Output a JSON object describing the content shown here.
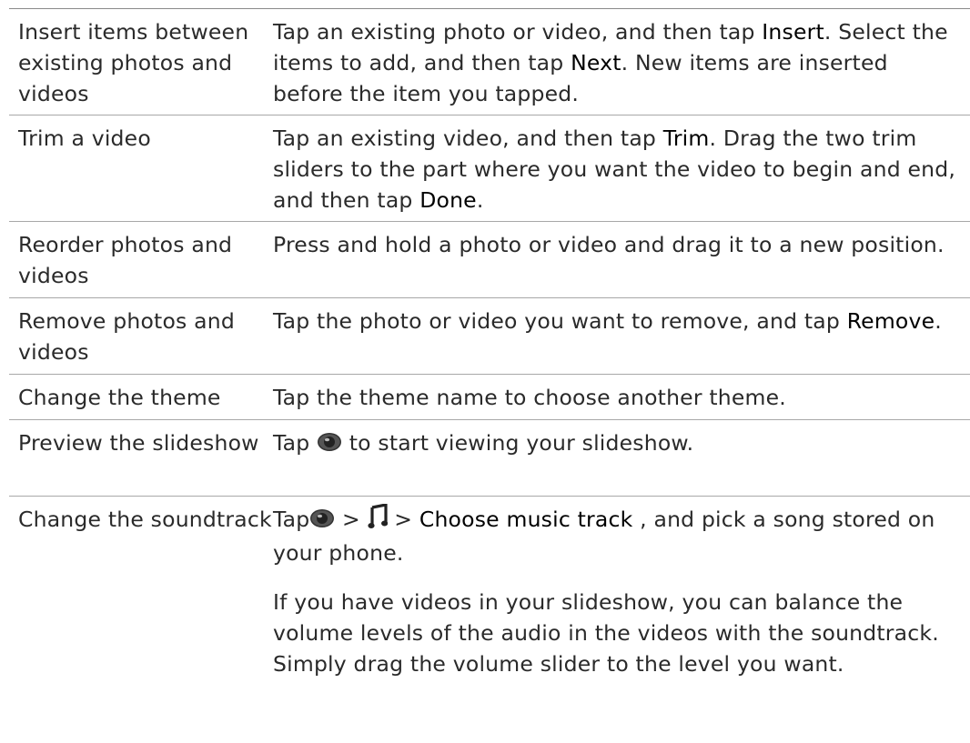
{
  "rows": [
    {
      "action": "Insert items between existing photos and videos",
      "desc": {
        "t1": "Tap an existing photo or video, and then tap ",
        "k1": "Insert",
        "t2": ". Select the items to add, and then tap ",
        "k2": "Next",
        "t3": ". New items are inserted before the item you tapped."
      }
    },
    {
      "action": "Trim a video",
      "desc": {
        "t1": "Tap an existing video, and then tap ",
        "k1": "Trim",
        "t2": ". Drag the two trim sliders to the part where you want the video to begin and end, and then tap ",
        "k2": "Done",
        "t3": "."
      }
    },
    {
      "action": "Reorder photos and videos",
      "desc": {
        "t1": "Press and hold a photo or video and drag it to a new position."
      }
    },
    {
      "action": "Remove photos and videos",
      "desc": {
        "t1": "Tap the photo or video you want to remove, and tap ",
        "k1": "Remove",
        "t2": "."
      }
    },
    {
      "action": "Change the theme",
      "desc": {
        "t1": "Tap the theme name to choose another theme."
      }
    },
    {
      "action": "Preview the slideshow",
      "desc": {
        "t1": "Tap ",
        "icon": "eye-icon",
        "t2": " to start viewing your slideshow."
      }
    },
    {
      "action": "Change the soundtrack",
      "desc": {
        "t1": "Tap",
        "icon1": "eye-icon",
        "sep1": " > ",
        "icon2": "music-note-icon",
        "sep2": " > ",
        "k1": "Choose music track",
        "t2": " , and pick a song stored on your phone.",
        "p2": "If you have videos in your slideshow, you can balance the volume levels of the audio in the videos with the soundtrack. Simply drag the volume slider to the level you want."
      }
    }
  ],
  "colors": {
    "text": "#2a2a2a",
    "rule": "#a8a8a8",
    "ui_term": "#000000",
    "icon": "#333333"
  }
}
